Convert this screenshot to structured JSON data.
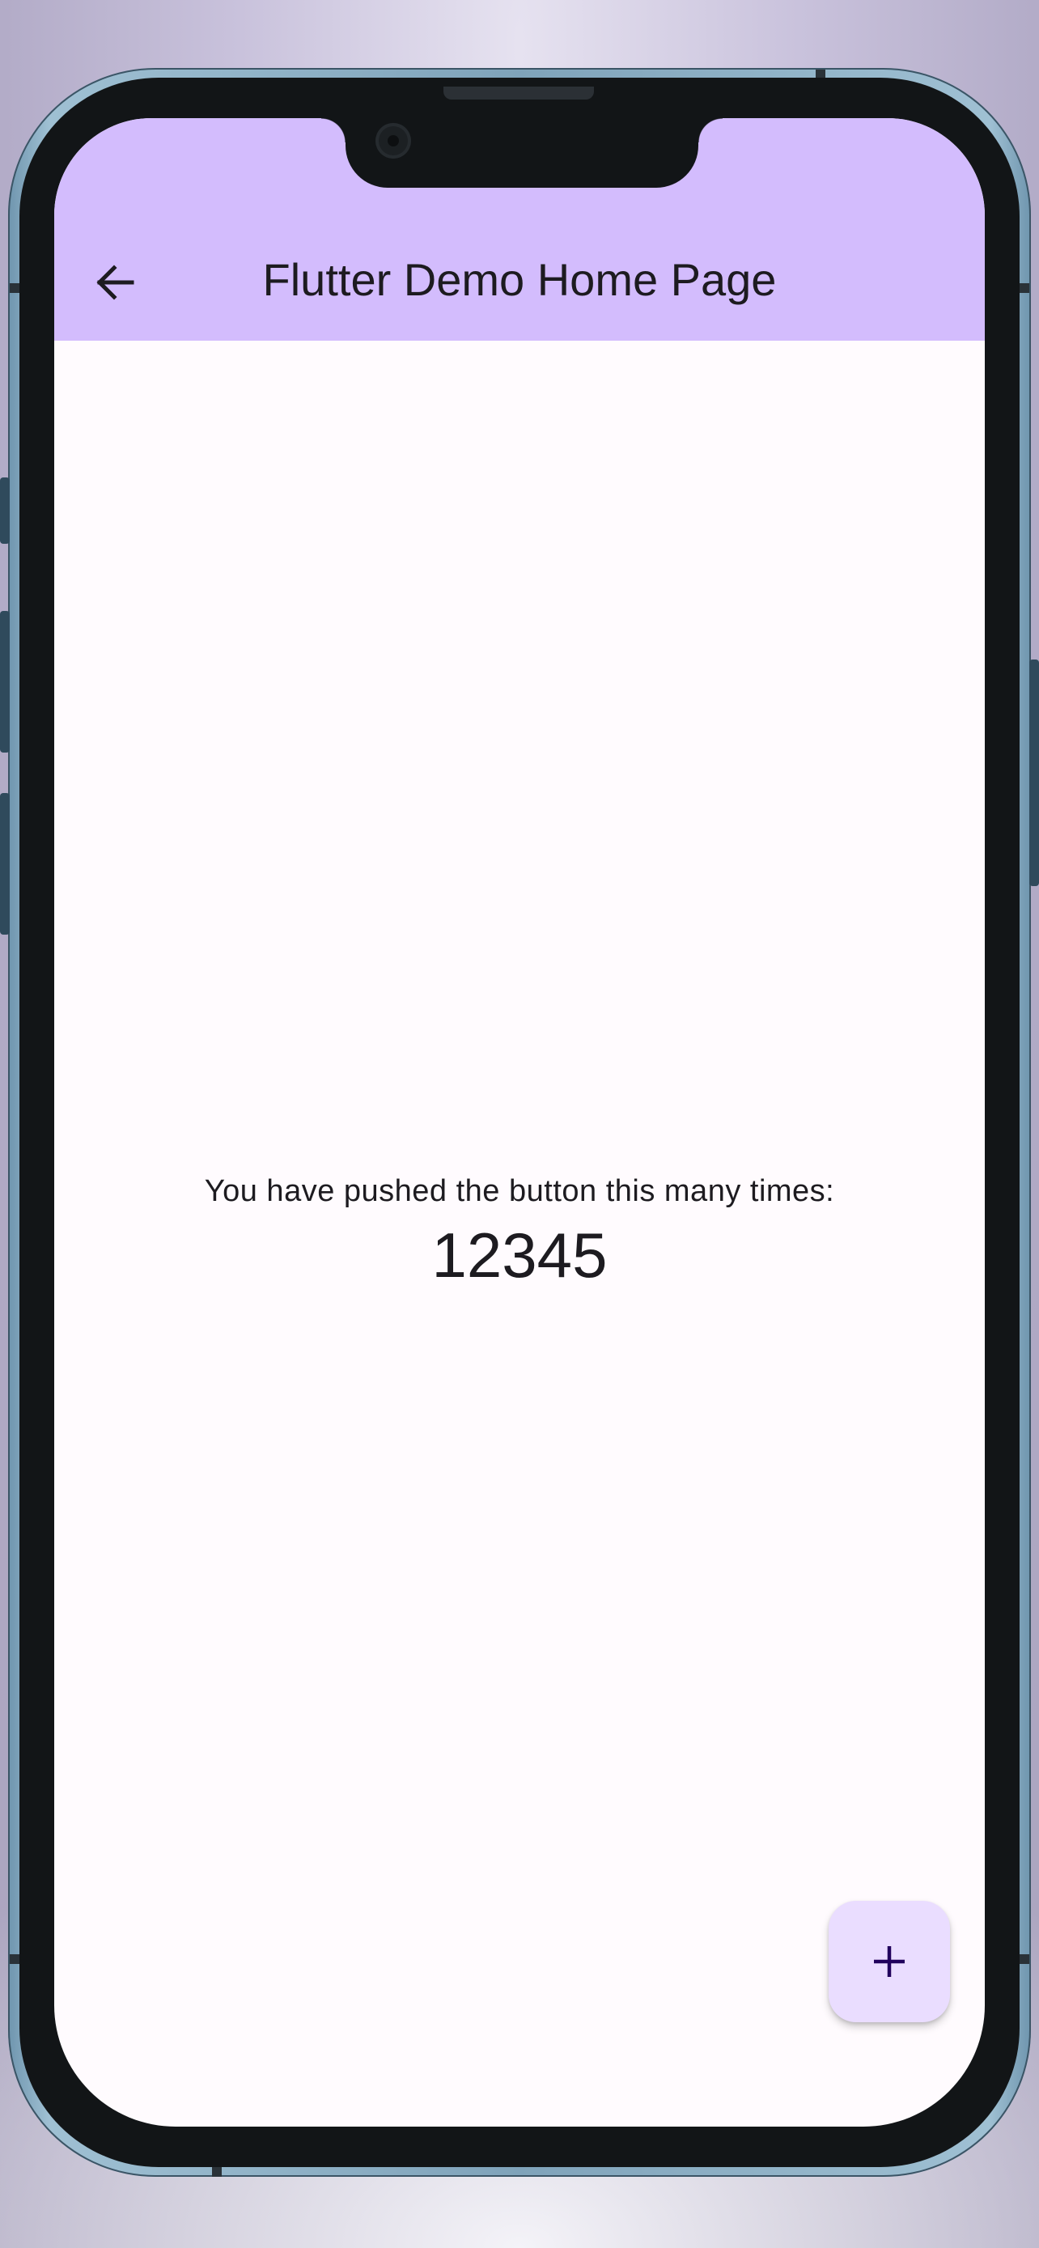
{
  "app_bar": {
    "title": "Flutter Demo Home Page",
    "back_icon": "arrow-back-icon",
    "background_color": "#d3bcfd",
    "title_color": "#1d1b20"
  },
  "main": {
    "counter_label": "You have pushed the button this many times:",
    "counter_value": "12345",
    "background_color": "#fffbfe"
  },
  "fab": {
    "icon": "plus-icon",
    "background_color": "#eaddff",
    "icon_color": "#21005d"
  }
}
